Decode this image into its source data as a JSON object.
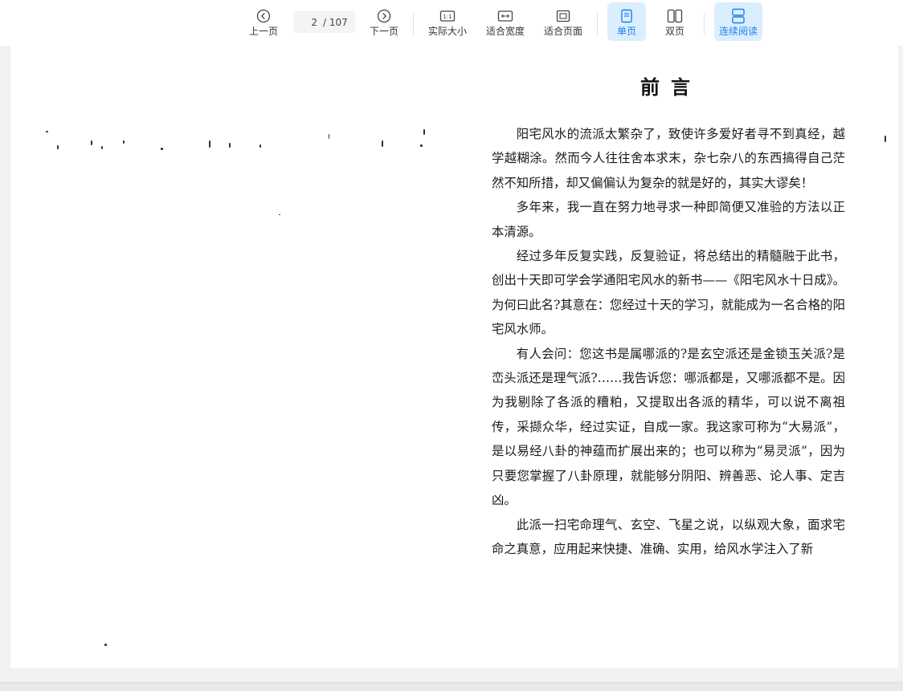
{
  "toolbar": {
    "prev_page": {
      "label": "上一页",
      "icon": "chevron-left-circle-icon"
    },
    "page_input": {
      "current": "2",
      "total": "/ 107"
    },
    "next_page": {
      "label": "下一页",
      "icon": "chevron-right-circle-icon"
    },
    "actual_size": {
      "label": "实际大小",
      "icon": "one-to-one-icon"
    },
    "fit_width": {
      "label": "适合宽度",
      "icon": "fit-width-icon"
    },
    "fit_page": {
      "label": "适合页面",
      "icon": "fit-page-icon"
    },
    "single_page": {
      "label": "单页",
      "icon": "single-page-icon",
      "active": true
    },
    "double_page": {
      "label": "双页",
      "icon": "double-page-icon",
      "active": false
    },
    "continuous_reading": {
      "label": "连续阅读",
      "icon": "continuous-scroll-icon",
      "active": true
    }
  },
  "document": {
    "title": "前言",
    "paragraphs": [
      "阳宅风水的流派太繁杂了，致使许多爱好者寻不到真经，越学越糊涂。然而今人往往舍本求末，杂七杂八的东西搞得自己茫然不知所措，却又偏偏认为复杂的就是好的，其实大谬矣！",
      "多年来，我一直在努力地寻求一种即简便又准验的方法以正本清源。",
      "经过多年反复实践，反复验证，将总结出的精髓融于此书，创出十天即可学会学通阳宅风水的新书——《阳宅风水十日成》。为何曰此名?其意在：您经过十天的学习，就能成为一名合格的阳宅风水师。",
      "有人会问：您这书是属哪派的?是玄空派还是金锁玉关派?是峦头派还是理气派?……我告诉您：哪派都是，又哪派都不是。因为我剔除了各派的糟粕，又提取出各派的精华，可以说不离祖传，采撷众华，经过实证，自成一家。我这家可称为“大易派”，是以易经八卦的神蕴而扩展出来的；也可以称为“易灵派”，因为只要您掌握了八卦原理，就能够分阴阳、辨善恶、论人事、定吉凶。",
      "此派一扫宅命理气、玄空、飞星之说，以纵观大象，面求宅命之真意，应用起来快捷、准确、实用，给风水学注入了新"
    ]
  },
  "colors": {
    "accent": "#1a7ff0",
    "active_bg": "#dbeefe",
    "toolbar_bg": "#ffffff",
    "viewer_bg": "#f2f2f2",
    "page_bg": "#ffffff"
  }
}
